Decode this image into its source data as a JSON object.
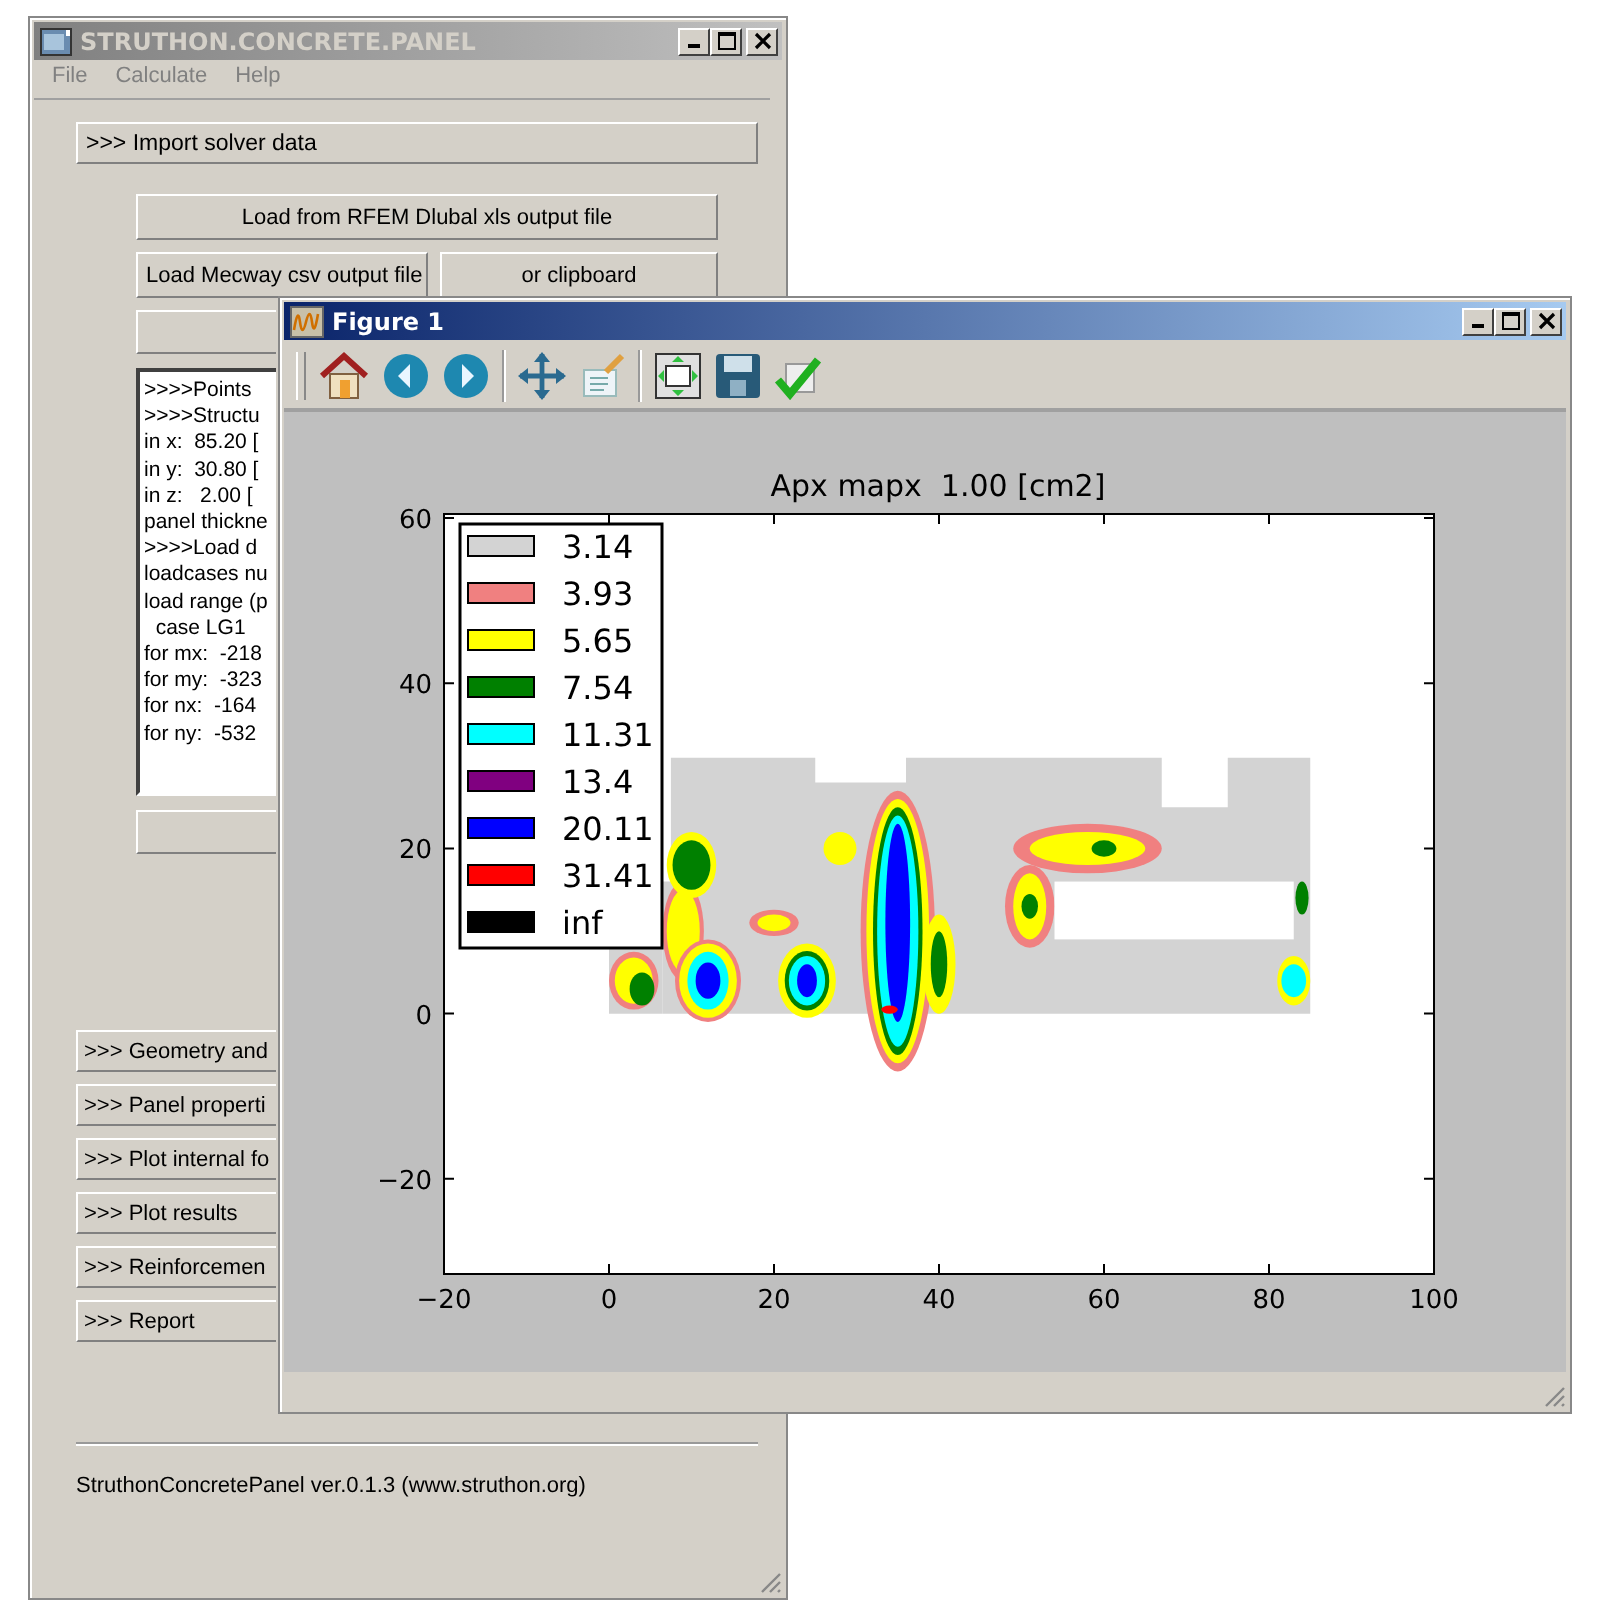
{
  "main_window": {
    "title": "STRUTHON.CONCRETE.PANEL",
    "menu": [
      "File",
      "Calculate",
      "Help"
    ],
    "import_button": ">>> Import solver data",
    "rfem_button": "Load from RFEM Dlubal xls output file",
    "mecway_button": "Load Mecway csv output file",
    "clipboard_button": "or clipboard",
    "log_lines": [
      ">>>>Points",
      ">>>>Structu",
      "in x:  85.20 [",
      "in y:  30.80 [",
      "in z:   2.00 [",
      "panel thickne",
      ">>>>Load d",
      "loadcases nu",
      "load range (p",
      "  case LG1",
      "for mx:  -218",
      "for my:  -323",
      "for nx:  -164",
      "for ny:  -532"
    ],
    "sections": [
      ">>> Geometry and",
      ">>> Panel properti",
      ">>> Plot internal fo",
      ">>> Plot results",
      ">>> Reinforcemen",
      ">>> Report"
    ],
    "footer": "StruthonConcretePanel ver.0.1.3  (www.struthon.org)"
  },
  "figure_window": {
    "title": "Figure 1",
    "plot": {
      "title": "Apx mapx  1.00 [cm2]",
      "xticks": [
        "−20",
        "0",
        "20",
        "40",
        "60",
        "80",
        "100"
      ],
      "yticks": [
        "60",
        "40",
        "20",
        "0",
        "−20"
      ],
      "legend": [
        {
          "label": "3.14",
          "color": "#d3d3d3"
        },
        {
          "label": "3.93",
          "color": "#f08080"
        },
        {
          "label": "5.65",
          "color": "#ffff00"
        },
        {
          "label": "7.54",
          "color": "#008000"
        },
        {
          "label": "11.31",
          "color": "#00ffff"
        },
        {
          "label": "13.4",
          "color": "#800080"
        },
        {
          "label": "20.11",
          "color": "#0000ff"
        },
        {
          "label": "31.41",
          "color": "#ff0000"
        },
        {
          "label": "inf",
          "color": "#000000"
        }
      ]
    }
  }
}
